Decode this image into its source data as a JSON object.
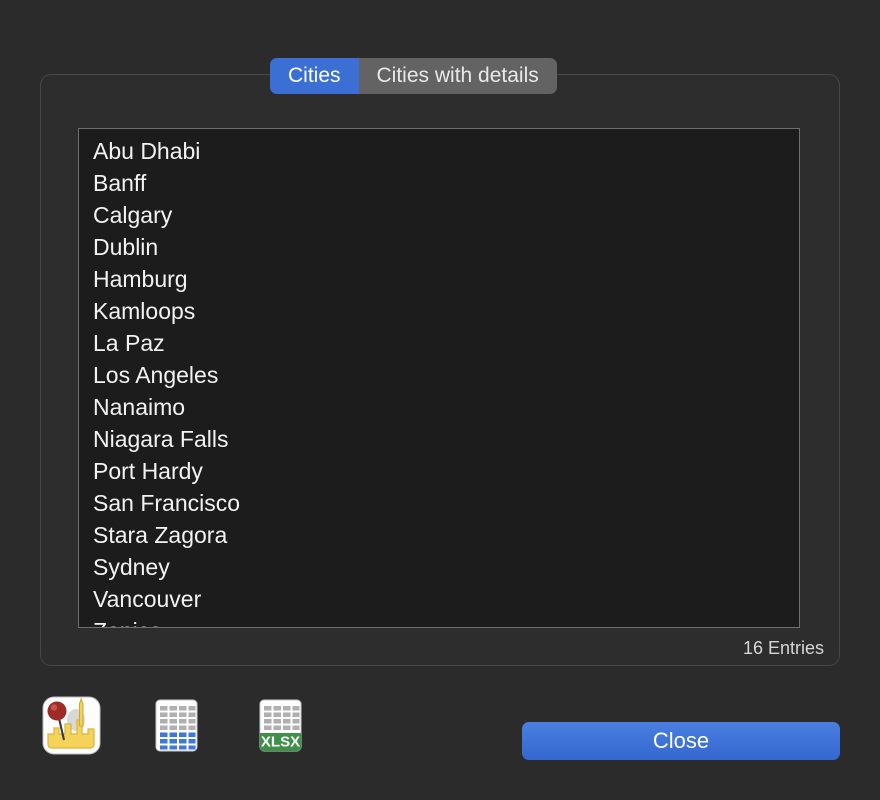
{
  "window": {
    "background_color": "#2b2b2b"
  },
  "tabs": {
    "items": [
      {
        "label": "Cities",
        "active": true
      },
      {
        "label": "Cities with details",
        "active": false
      }
    ],
    "active_color": "#3b6fd4",
    "inactive_color": "#636363"
  },
  "list": {
    "items": [
      "Abu Dhabi",
      "Banff",
      "Calgary",
      "Dublin",
      "Hamburg",
      "Kamloops",
      "La Paz",
      "Los Angeles",
      "Nanaimo",
      "Niagara Falls",
      "Port Hardy",
      "San Francisco",
      "Stara Zagora",
      "Sydney",
      "Vancouver",
      "Zenica"
    ],
    "background_color": "#1c1c1c",
    "text_color": "#f2f2f2"
  },
  "status": {
    "entries_label": "16 Entries"
  },
  "toolbar": {
    "icons": [
      {
        "name": "city-map-pin-icon",
        "label": ""
      },
      {
        "name": "table-grid-icon",
        "label": ""
      },
      {
        "name": "xlsx-export-icon",
        "label": "XLSX"
      }
    ]
  },
  "actions": {
    "close_label": "Close",
    "close_color": "#3b6fd4"
  }
}
